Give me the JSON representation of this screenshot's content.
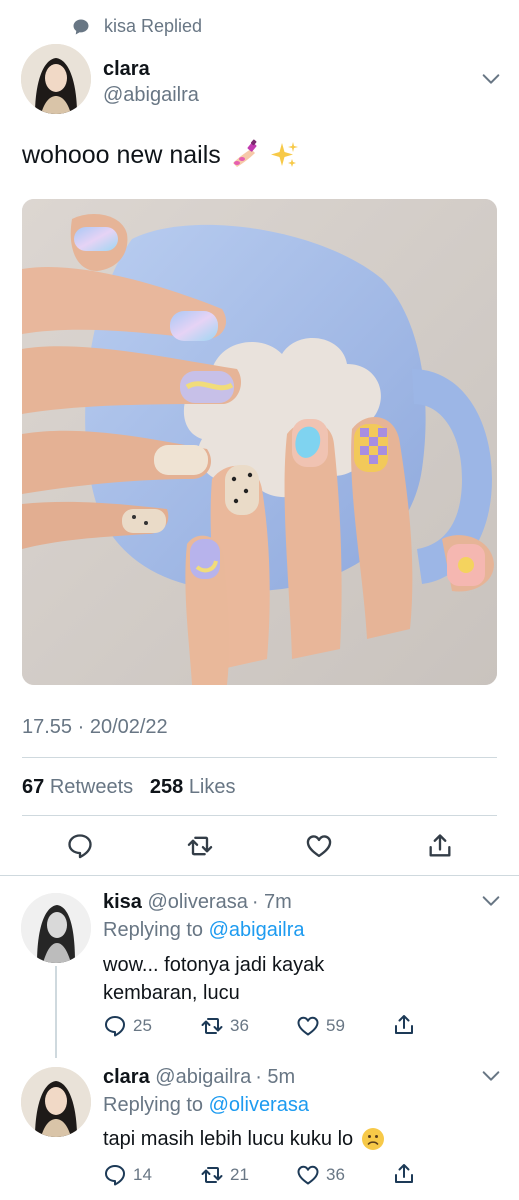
{
  "context": {
    "text": "kisa Replied",
    "icon": "speech-bubble-icon"
  },
  "main_tweet": {
    "name": "clara",
    "handle": "@abigailra",
    "text": "wohooo new nails",
    "emoji_icons": [
      "nail-polish-emoji-icon",
      "sparkles-emoji-icon"
    ],
    "timestamp": "17.55 · 20/02/22",
    "retweets_count": "67",
    "retweets_label": "Retweets",
    "likes_count": "258",
    "likes_label": "Likes",
    "actions": [
      "reply-icon",
      "retweet-icon",
      "like-icon",
      "share-icon"
    ]
  },
  "replies": [
    {
      "name": "kisa",
      "handle": "@oliverasa",
      "time": "· 7m",
      "replying_prefix": "Replying to",
      "replying_to": "@abigailra",
      "text_line1": "wow... fotonya jadi kayak",
      "text_line2": "kembaran, lucu",
      "reply_count": "25",
      "retweet_count": "36",
      "like_count": "59"
    },
    {
      "name": "clara",
      "handle": "@abigailra",
      "time": "· 5m",
      "replying_prefix": "Replying to",
      "replying_to": "@oliverasa",
      "text": "tapi masih lebih lucu kuku lo",
      "emoji_icon": "frowning-face-emoji-icon",
      "reply_count": "14",
      "retweet_count": "21",
      "like_count": "36"
    }
  ],
  "colors": {
    "link": "#1d9bf0",
    "muted": "#687684",
    "text": "#0f1419",
    "divider": "#cfd9de"
  }
}
